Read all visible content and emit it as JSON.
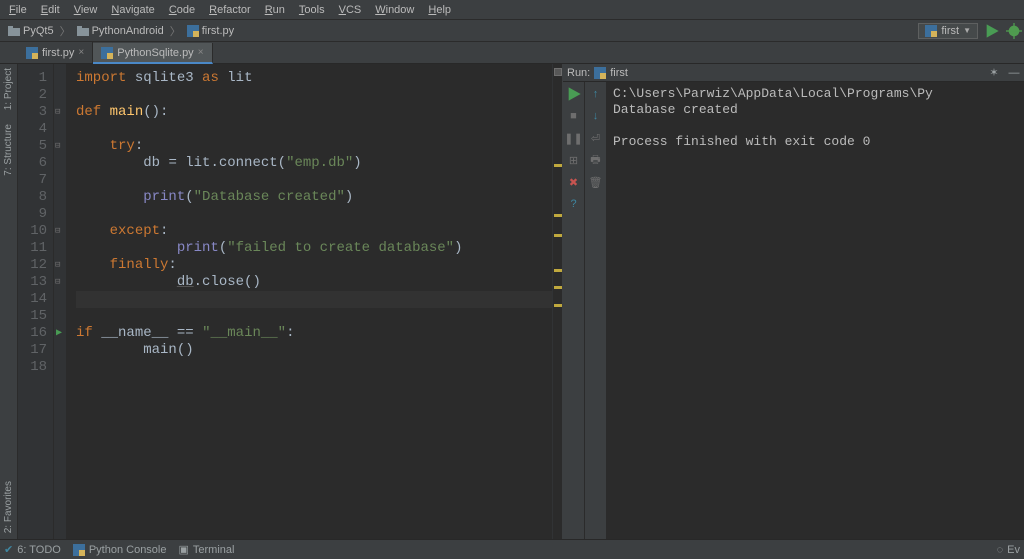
{
  "menu": [
    "File",
    "Edit",
    "View",
    "Navigate",
    "Code",
    "Refactor",
    "Run",
    "Tools",
    "VCS",
    "Window",
    "Help"
  ],
  "breadcrumb": {
    "project": "PyQt5",
    "folder": "PythonAndroid",
    "file": "first.py"
  },
  "run_config": {
    "name": "first"
  },
  "tabs": [
    {
      "label": "first.py",
      "active": false
    },
    {
      "label": "PythonSqlite.py",
      "active": true
    }
  ],
  "side_tools": {
    "project": "1: Project",
    "structure": "7: Structure",
    "favorites": "2: Favorites"
  },
  "code": {
    "lines": [
      {
        "n": 1,
        "seg": [
          [
            "kw",
            "import"
          ],
          [
            "",
            ""
          ],
          [
            "id",
            " sqlite3 "
          ],
          [
            "kw",
            "as"
          ],
          [
            "id",
            " lit"
          ]
        ]
      },
      {
        "n": 2,
        "seg": []
      },
      {
        "n": 3,
        "seg": [
          [
            "kw",
            "def "
          ],
          [
            "fn",
            "main"
          ],
          [
            "op",
            "():"
          ]
        ]
      },
      {
        "n": 4,
        "seg": []
      },
      {
        "n": 5,
        "seg": [
          [
            "",
            "    "
          ],
          [
            "kw",
            "try"
          ],
          [
            "op",
            ":"
          ]
        ]
      },
      {
        "n": 6,
        "seg": [
          [
            "",
            "        "
          ],
          [
            "id",
            "db "
          ],
          [
            "op",
            "= "
          ],
          [
            "id",
            "lit.connect("
          ],
          [
            "str",
            "\"emp.db\""
          ],
          [
            "op",
            ")"
          ]
        ]
      },
      {
        "n": 7,
        "seg": []
      },
      {
        "n": 8,
        "seg": [
          [
            "",
            "        "
          ],
          [
            "builtin",
            "print"
          ],
          [
            "op",
            "("
          ],
          [
            "str",
            "\"Database created\""
          ],
          [
            "op",
            ")"
          ]
        ]
      },
      {
        "n": 9,
        "seg": []
      },
      {
        "n": 10,
        "seg": [
          [
            "",
            "    "
          ],
          [
            "kw",
            "except"
          ],
          [
            "op",
            ":"
          ]
        ]
      },
      {
        "n": 11,
        "seg": [
          [
            "",
            "            "
          ],
          [
            "builtin",
            "print"
          ],
          [
            "op",
            "("
          ],
          [
            "str",
            "\"failed to create database\""
          ],
          [
            "op",
            ")"
          ]
        ]
      },
      {
        "n": 12,
        "seg": [
          [
            "",
            "    "
          ],
          [
            "kw",
            "finally"
          ],
          [
            "op",
            ":"
          ]
        ]
      },
      {
        "n": 13,
        "seg": [
          [
            "",
            "            "
          ],
          [
            "id underline",
            "db"
          ],
          [
            "op",
            ".close()"
          ]
        ]
      },
      {
        "n": 14,
        "seg": [],
        "current": true
      },
      {
        "n": 15,
        "seg": []
      },
      {
        "n": 16,
        "seg": [
          [
            "kw",
            "if "
          ],
          [
            "id",
            "__name__ "
          ],
          [
            "op",
            "== "
          ],
          [
            "str",
            "\"__main__\""
          ],
          [
            "op",
            ":"
          ]
        ],
        "runicon": true
      },
      {
        "n": 17,
        "seg": [
          [
            "",
            "        "
          ],
          [
            "id",
            "main()"
          ]
        ]
      },
      {
        "n": 18,
        "seg": []
      }
    ]
  },
  "run_panel": {
    "header_label": "Run:",
    "header_name": "first",
    "output": "C:\\Users\\Parwiz\\AppData\\Local\\Programs\\Py\nDatabase created\n\nProcess finished with exit code 0"
  },
  "bottom": {
    "todo": "6: TODO",
    "python_console": "Python Console",
    "terminal": "Terminal",
    "event_log": "Ev"
  }
}
